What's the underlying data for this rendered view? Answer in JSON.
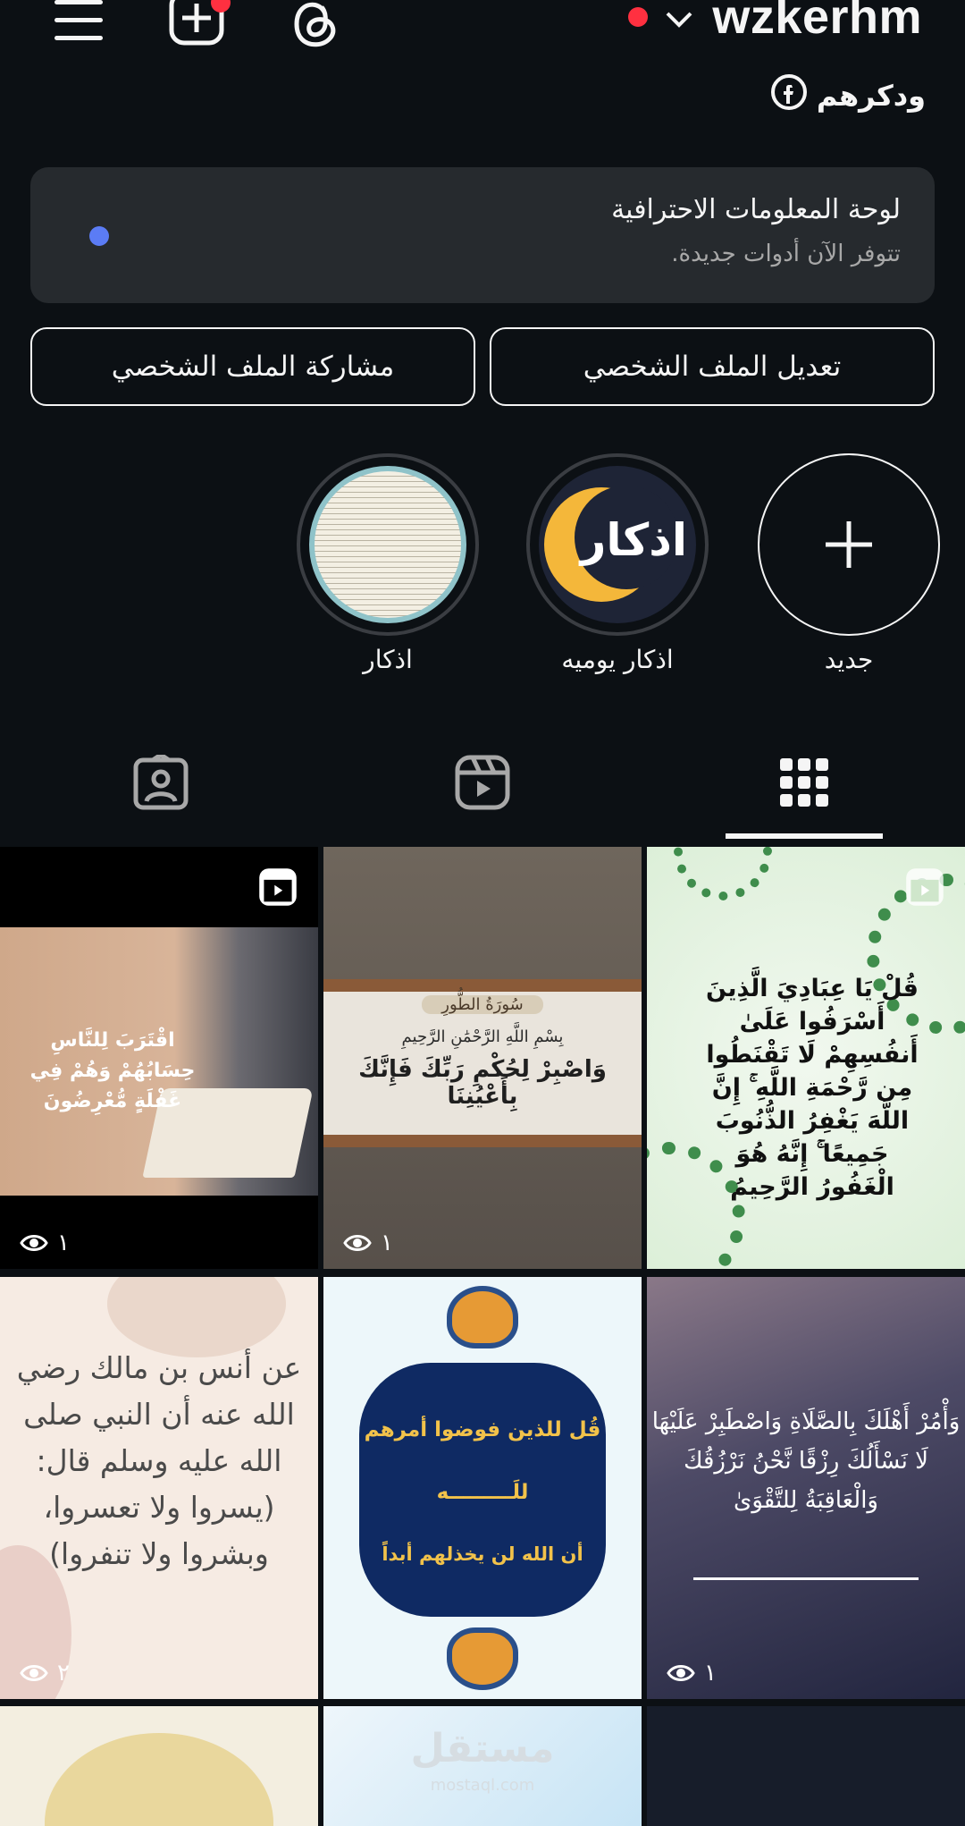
{
  "header": {
    "username": "wzkerhm",
    "facebook_link_text": "ودكرهم",
    "icons": [
      "menu-icon",
      "create-icon",
      "threads-icon",
      "chevron-down-icon"
    ]
  },
  "pro_dashboard": {
    "title": "لوحة المعلومات الاحترافية",
    "subtitle": "تتوفر الآن أدوات جديدة."
  },
  "actions": {
    "edit_profile": "تعديل الملف الشخصي",
    "share_profile": "مشاركة الملف الشخصي"
  },
  "highlights": [
    {
      "label": "جديد",
      "cover_text": "+"
    },
    {
      "label": "اذكار يوميه",
      "cover_text": "اذكار"
    },
    {
      "label": "اذكار",
      "cover_text": ""
    }
  ],
  "tabs": [
    "grid-icon",
    "reels-icon",
    "tagged-icon"
  ],
  "posts": [
    {
      "views": "١",
      "text": "اقْتَرَبَ لِلنَّاسِ حِسَابُهُمْ وَهُمْ فِي غَفْلَةٍ مُّعْرِضُونَ",
      "reel": true
    },
    {
      "views": "١",
      "text": "وَاصْبِرْ لِحُكْمِ رَبِّكَ فَإِنَّكَ بِأَعْيُنِنَا",
      "header": "سُورَةُ الطُّورِ",
      "basmala": "بِسْمِ اللَّهِ الرَّحْمَٰنِ الرَّحِيمِ",
      "reel": false
    },
    {
      "views": "",
      "text": "قُلْ يَا عِبَادِيَ الَّذِينَ أَسْرَفُوا عَلَىٰ أَنفُسِهِمْ لَا تَقْنَطُوا مِن رَّحْمَةِ اللَّهِ ۚ إِنَّ اللَّهَ يَغْفِرُ الذُّنُوبَ جَمِيعًا ۚ إِنَّهُ هُوَ الْغَفُورُ الرَّحِيمُ",
      "reel": true
    },
    {
      "views": "٢",
      "text": "عن أنس بن مالك رضي الله عنه أن النبي صلى الله عليه وسلم قال: (يسروا ولا تعسروا، وبشروا ولا تنفروا)",
      "reel": false
    },
    {
      "views": "",
      "line1": "قُل للذين فوضوا أمرهم",
      "line2": "للَـــــــــه",
      "line3": "أن الله لن يخذلهم أبداً",
      "reel": false
    },
    {
      "views": "١",
      "text": "وَأْمُرْ أَهْلَكَ بِالصَّلَاةِ وَاصْطَبِرْ عَلَيْهَا لَا نَسْأَلُكَ رِزْقًا نَّحْنُ نَرْزُقُكَ وَالْعَاقِبَةُ لِلتَّقْوَىٰ",
      "reel": false
    }
  ],
  "watermark": {
    "brand": "مستقل",
    "url": "mostaql.com"
  }
}
